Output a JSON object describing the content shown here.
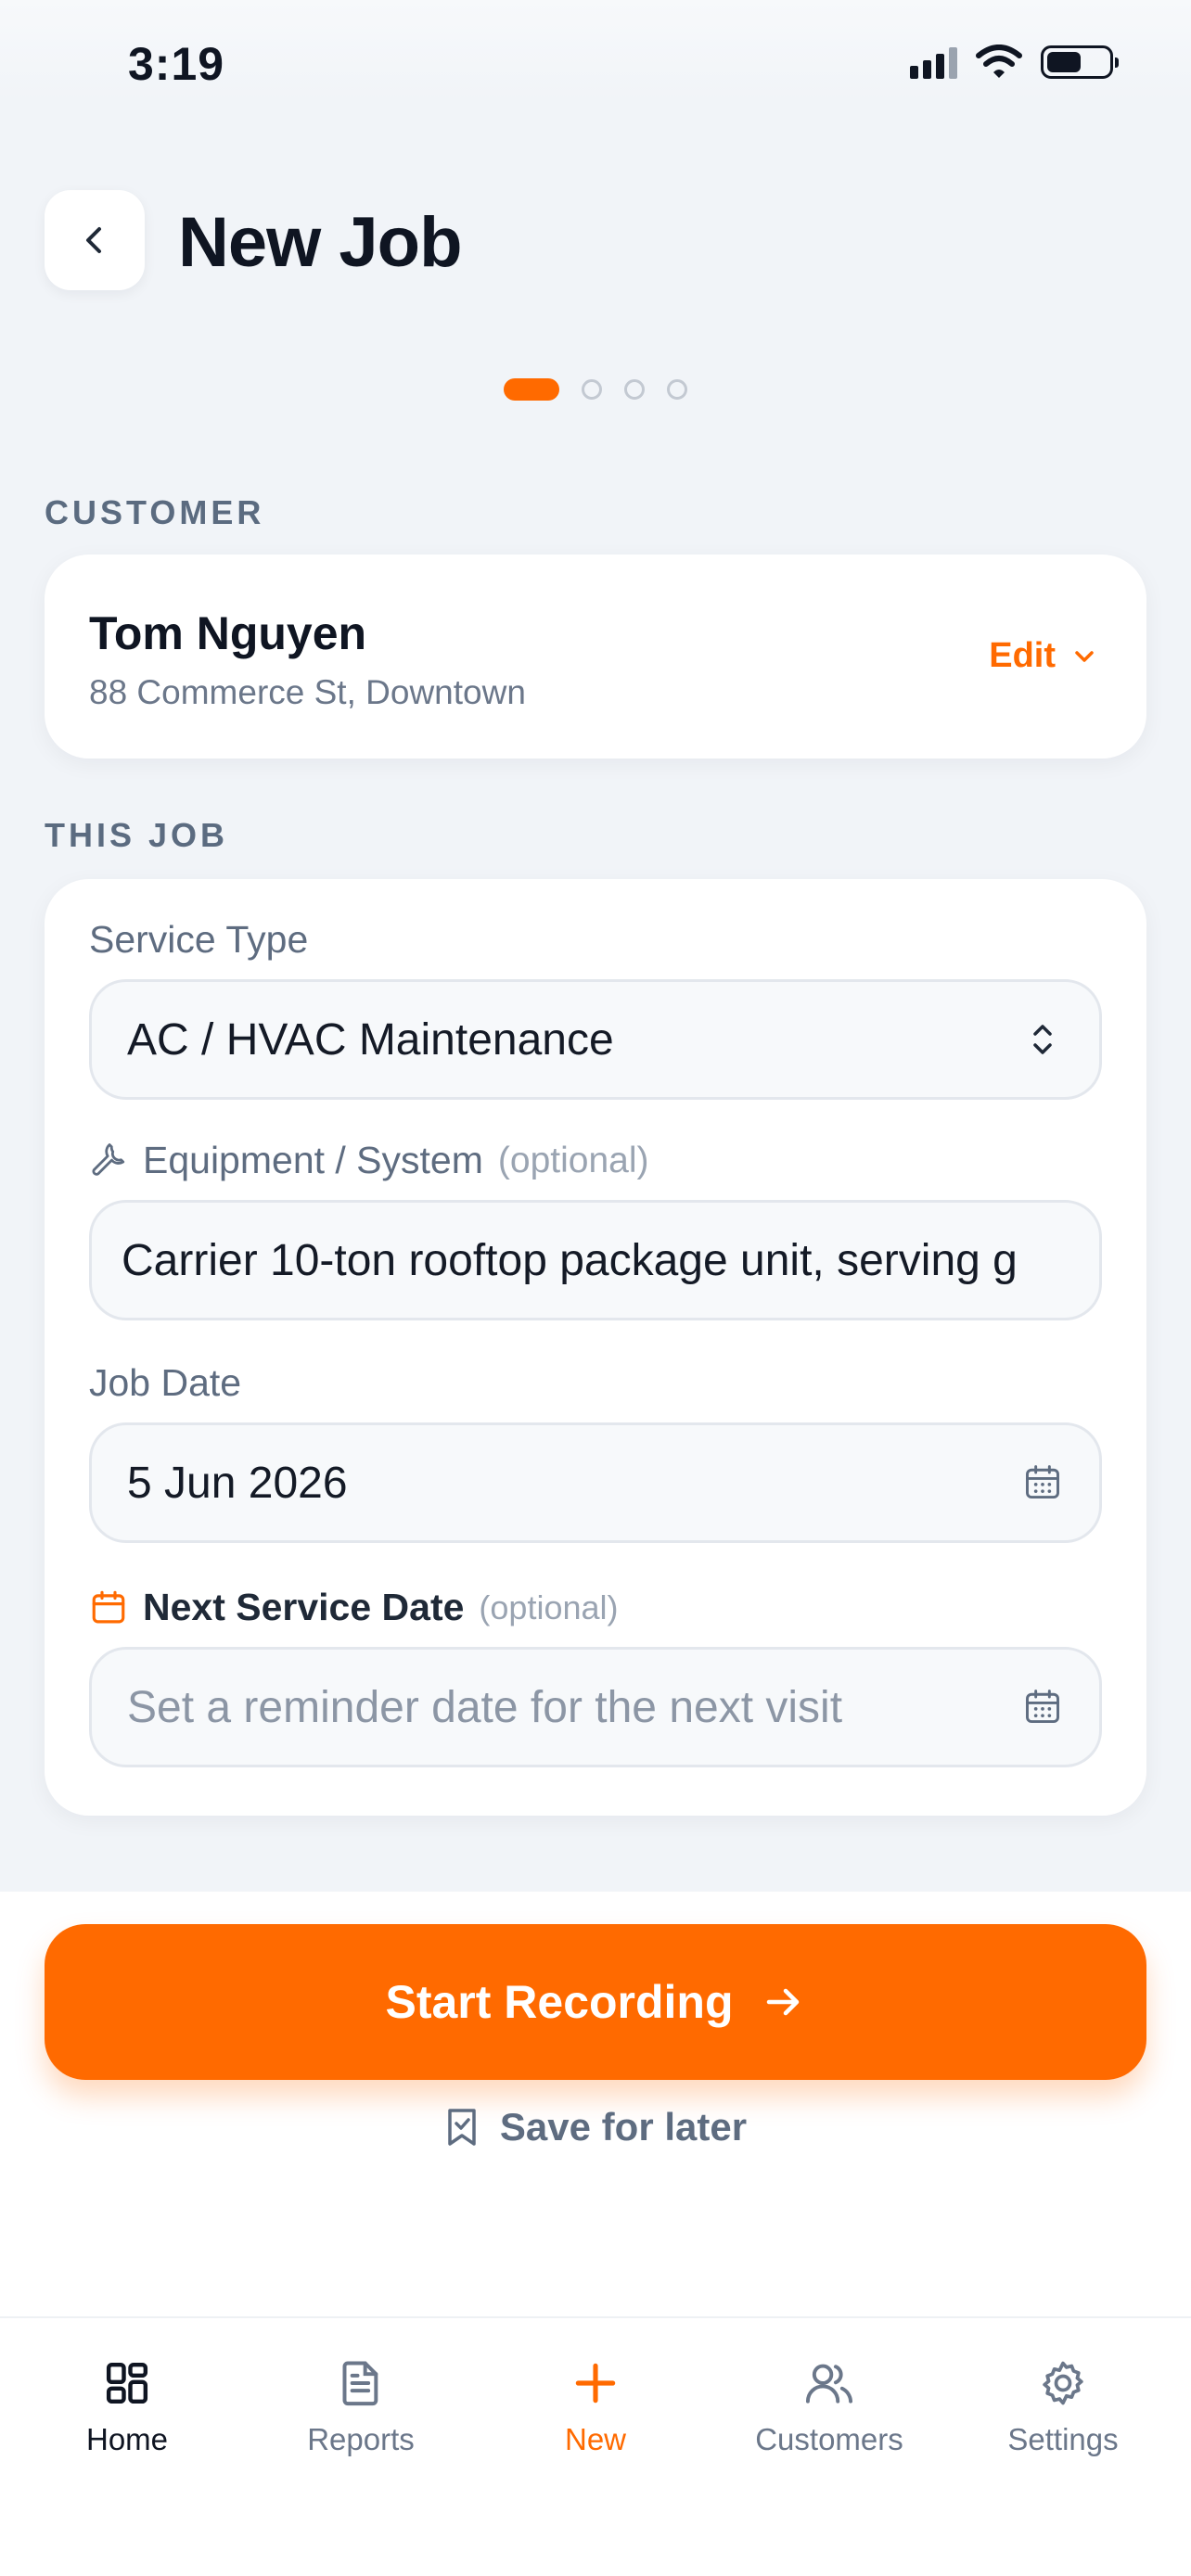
{
  "status_bar": {
    "time": "3:19"
  },
  "header": {
    "title": "New Job"
  },
  "stepper": {
    "total": 4,
    "current": 1
  },
  "customer_section": {
    "label": "CUSTOMER",
    "name": "Tom Nguyen",
    "address": "88 Commerce St, Downtown",
    "edit_label": "Edit"
  },
  "job_section": {
    "label": "THIS JOB",
    "service_type": {
      "label": "Service Type",
      "value": "AC / HVAC Maintenance"
    },
    "equipment": {
      "label": "Equipment / System",
      "optional": "(optional)",
      "value": "Carrier 10-ton rooftop package unit, serving g"
    },
    "job_date": {
      "label": "Job Date",
      "value": "5 Jun 2026"
    },
    "next_service": {
      "label": "Next Service Date",
      "optional": "(optional)",
      "placeholder": "Set a reminder date for the next visit"
    }
  },
  "actions": {
    "primary": "Start Recording",
    "secondary": "Save for later"
  },
  "tabbar": {
    "items": [
      {
        "label": "Home",
        "icon": "home-grid-icon"
      },
      {
        "label": "Reports",
        "icon": "document-icon"
      },
      {
        "label": "New",
        "icon": "plus-icon"
      },
      {
        "label": "Customers",
        "icon": "users-icon"
      },
      {
        "label": "Settings",
        "icon": "gear-icon"
      }
    ],
    "active": "Home"
  },
  "colors": {
    "accent": "#ff6a00",
    "background": "#f1f4f8",
    "muted": "#5e6c80"
  }
}
